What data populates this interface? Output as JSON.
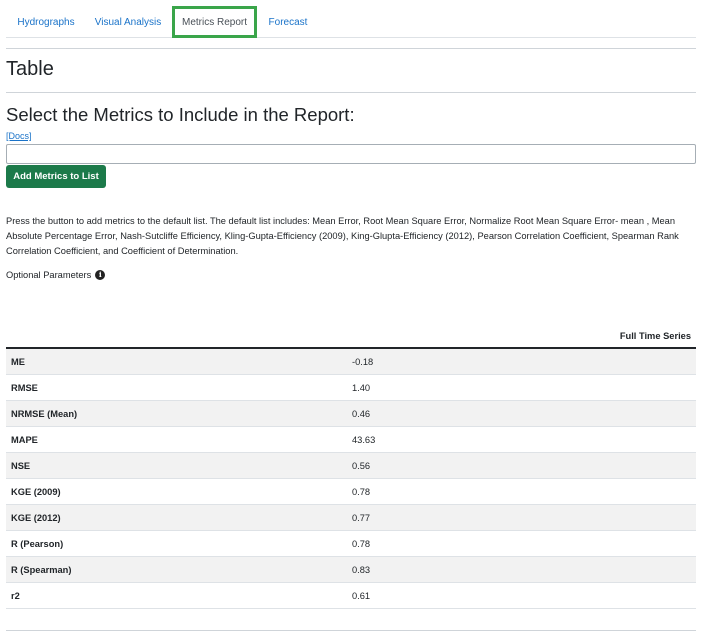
{
  "tabs": [
    {
      "label": "Hydrographs"
    },
    {
      "label": "Visual Analysis"
    },
    {
      "label": "Metrics Report"
    },
    {
      "label": "Forecast"
    }
  ],
  "active_tab": "Metrics Report",
  "active_tab_border_color": "#3aa54a",
  "page_title": "Table",
  "section_title": "Select the Metrics to Include in the Report:",
  "docs_link": "[Docs]",
  "metric_input": {
    "value": "",
    "placeholder": ""
  },
  "add_button_label": "Add Metrics to List",
  "add_button_color": "#1c7a4a",
  "description": "Press the button to add metrics to the default list. The default list includes: Mean Error, Root Mean Square Error, Normalize Root Mean Square Error- mean , Mean Absolute Percentage Error, Nash-Sutcliffe Efficiency, Kling-Gupta-Efficiency (2009), King-Glupta-Efficiency (2012), Pearson Correlation Coefficient, Spearman Rank Correlation Coefficient, and Coefficient of Determination.",
  "optional_parameters_label": "Optional Parameters",
  "info_icon": "info-circle-icon",
  "table": {
    "header": "Full Time Series",
    "rows": [
      {
        "metric": "ME",
        "value": "-0.18"
      },
      {
        "metric": "RMSE",
        "value": "1.40"
      },
      {
        "metric": "NRMSE (Mean)",
        "value": "0.46"
      },
      {
        "metric": "MAPE",
        "value": "43.63"
      },
      {
        "metric": "NSE",
        "value": "0.56"
      },
      {
        "metric": "KGE (2009)",
        "value": "0.78"
      },
      {
        "metric": "KGE (2012)",
        "value": "0.77"
      },
      {
        "metric": "R (Pearson)",
        "value": "0.78"
      },
      {
        "metric": "R (Spearman)",
        "value": "0.83"
      },
      {
        "metric": "r2",
        "value": "0.61"
      }
    ]
  }
}
